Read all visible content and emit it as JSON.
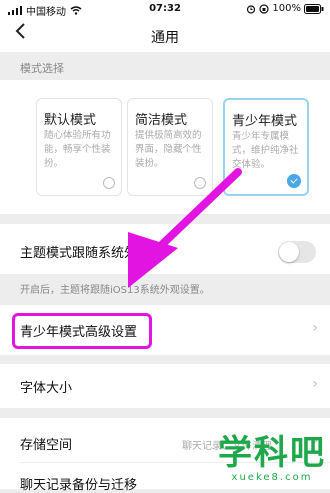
{
  "status": {
    "carrier": "中国移动",
    "time": "07:32",
    "battery": "100%"
  },
  "nav": {
    "back_icon": "chevron-left-icon",
    "title": "通用"
  },
  "mode_section": {
    "label": "模式选择",
    "modes": [
      {
        "title": "默认模式",
        "desc": "随心体验所有功能，畅享个性装扮。",
        "selected": false
      },
      {
        "title": "简洁模式",
        "desc": "提供极简高效的界面，隐藏个性装扮。",
        "selected": false
      },
      {
        "title": "青少年模式",
        "desc": "青少年专属模式，维护纯净社交体验。",
        "selected": true
      }
    ]
  },
  "theme_follow": {
    "label": "主题模式跟随系统外",
    "hint": "开启后，主题将跟随iOS13系统外观设置。",
    "on": false
  },
  "teen_advanced": {
    "label": "青少年模式高级设置"
  },
  "font_size": {
    "label": "字体大小"
  },
  "storage": {
    "label": "存储空间",
    "value": "聊天记录、文件清理"
  },
  "backup": {
    "label": "聊天记录备份与迁移"
  },
  "watermark": {
    "big": "学科吧",
    "small": "xueke8.com"
  },
  "colors": {
    "accent": "#4aa8e6",
    "highlight": "#e214e2",
    "arrow": "#e214e2",
    "watermark": "#1ea84a"
  }
}
